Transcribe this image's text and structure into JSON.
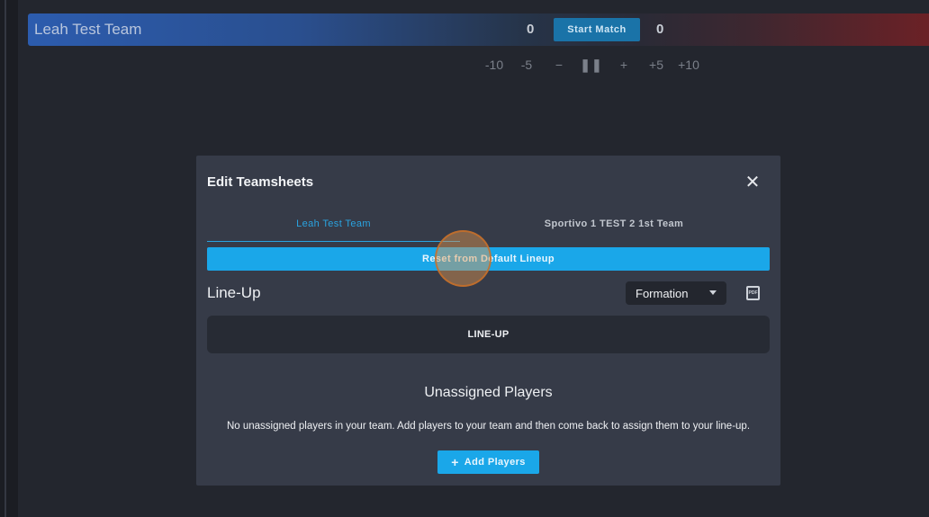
{
  "scoreboard": {
    "home_team": "Leah Test Team",
    "home_score": "0",
    "start_match_label": "Start Match",
    "away_score": "0",
    "colors": {
      "home": "#2c5cae",
      "away": "#6b2126",
      "start_button": "#1a73a8"
    }
  },
  "time_controls": [
    "-10",
    "-5",
    "−",
    "❚❚",
    "+",
    "+5",
    "+10"
  ],
  "modal": {
    "title": "Edit Teamsheets",
    "close_icon": "close-icon",
    "tabs": [
      {
        "label": "Leah Test Team",
        "active": true
      },
      {
        "label": "Sportivo 1 TEST 2 1st Team",
        "active": false
      }
    ],
    "reset_label": "Reset from Default Lineup",
    "lineup_title": "Line-Up",
    "formation_label": "Formation",
    "pdf_icon_text": "PDF",
    "lineup_box_label": "LINE-UP",
    "unassigned_title": "Unassigned Players",
    "unassigned_message": "No unassigned players in your team. Add players to your team and then come back to assign them to your line-up.",
    "add_players_label": "Add Players",
    "accent_color": "#1aa7e9"
  }
}
